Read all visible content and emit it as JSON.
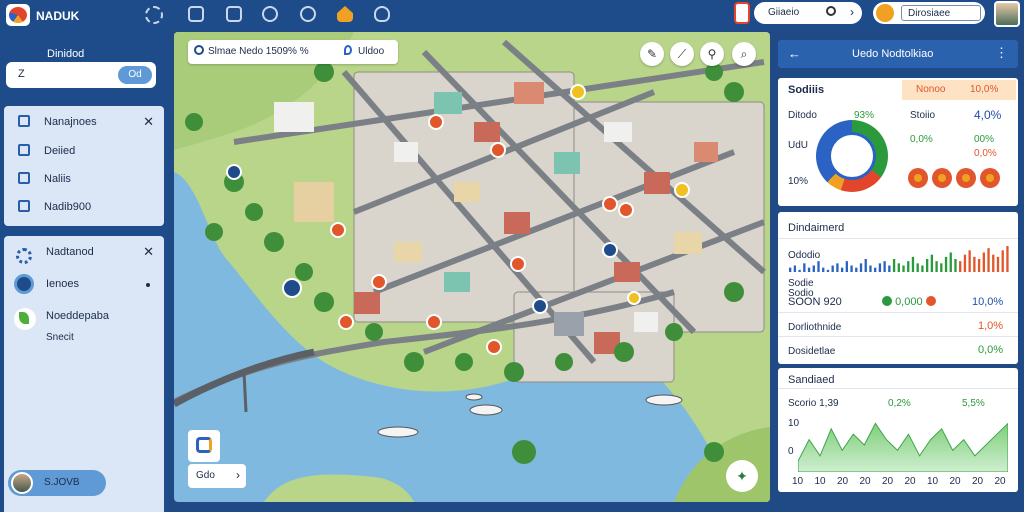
{
  "topbar": {
    "brand": "NADUK",
    "search_text": "Giiaeio",
    "user_box": "Dirosiaee"
  },
  "sidebar": {
    "title": "Dinidod",
    "search_z": "Z",
    "search_pill": "Od",
    "panel1": {
      "title": "Nanajnoes",
      "items": [
        "Deiied",
        "Naliis",
        "Nadib900"
      ]
    },
    "panel2": {
      "title": "Nadtanod",
      "item1": "Ienoes",
      "item2": "Noeddepaba",
      "item2_sub": "Snecit"
    },
    "user": "S.JOVB"
  },
  "map": {
    "search_text": "Slmae   Nedo 1509% %",
    "search_loc": "Uldoo",
    "pill_text": "Gdo"
  },
  "right": {
    "header_title": "Uedo Nodtolkiao",
    "card1": {
      "title": "Sodiiis",
      "hl_left": "Nonoo",
      "hl_right": "10,0%",
      "r1_label": "Ditodo",
      "r1_val": "93%",
      "r1b_label": "Stoiio",
      "r1b_val": "4,0%",
      "r2_label": "UdU",
      "r2_val1": "0,0%",
      "r2_val2": "00%",
      "r2_val3": "0,0%",
      "r3_label": "10%",
      "donut_colors": [
        "#2a9a3c",
        "#e2452b",
        "#f0a023",
        "#2a63c4"
      ]
    },
    "card2": {
      "title": "Dindaimerd",
      "r1": "Ododio",
      "r2_label": "Sodie",
      "r2_label_b": "Sodio",
      "r3_label": "SOON 920",
      "r3_val": "0,000",
      "r3_pct": "10,0%",
      "r4_label": "Dorliothnide",
      "r4_val": "1,0%",
      "r5_label": "Dosidetlae",
      "r5_val": "0,0%"
    },
    "card3": {
      "title": "Sandiaed",
      "r1_label": "Scorio 1,39",
      "r1_val": "0,2%",
      "r1_pct": "5,5%",
      "y_ticks": [
        "10",
        "0"
      ],
      "x_ticks": [
        "10",
        "10",
        "20",
        "20",
        "20",
        "20",
        "10",
        "20",
        "20",
        "20"
      ]
    }
  },
  "chart_data": {
    "type": "area",
    "x": [
      1,
      2,
      3,
      4,
      5,
      6,
      7,
      8,
      9,
      10,
      11,
      12,
      13,
      14,
      15,
      16,
      17,
      18,
      19,
      20
    ],
    "values": [
      2,
      6,
      3,
      8,
      4,
      7,
      5,
      9,
      6,
      4,
      7,
      3,
      6,
      8,
      4,
      6,
      3,
      5,
      7,
      9
    ],
    "xlabel": "",
    "ylabel": ""
  },
  "bars": [
    2,
    3,
    1,
    4,
    2,
    3,
    5,
    2,
    1,
    3,
    4,
    2,
    5,
    3,
    2,
    4,
    6,
    3,
    2,
    4,
    5,
    3,
    6,
    4,
    3,
    5,
    7,
    4,
    3,
    6,
    8,
    5,
    4,
    7,
    9,
    6,
    5,
    8,
    10,
    7,
    6,
    9,
    11,
    8,
    7,
    10,
    12
  ],
  "bars_colors": {
    "blue": "#2a63c4",
    "green": "#2b9a3c",
    "orange": "#e2562b"
  }
}
